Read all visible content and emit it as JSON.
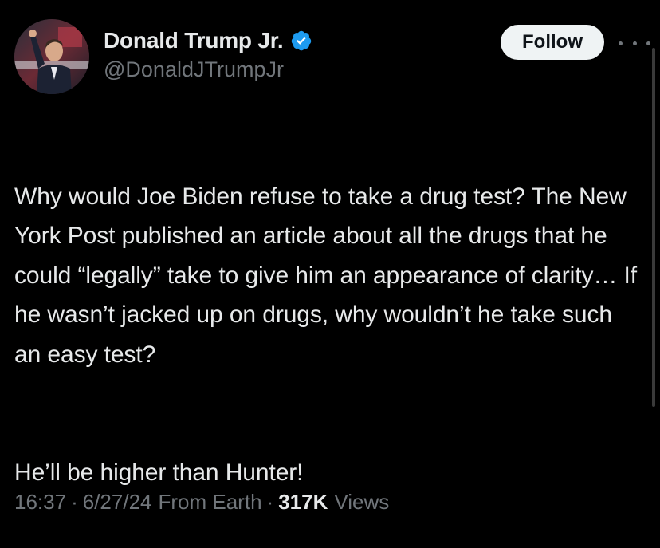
{
  "author": {
    "display_name": "Donald Trump Jr.",
    "handle": "@DonaldJTrumpJr",
    "verified": true,
    "verified_badge_color": "#1d9bf0"
  },
  "actions": {
    "follow_label": "Follow",
    "more_icon": "more-horizontal-icon"
  },
  "tweet": {
    "paragraphs": [
      "Why would Joe Biden refuse to take a drug test? The New York Post published an article about all the drugs that he could “legally” take to give him an appearance of clarity… If he wasn’t jacked up on drugs, why wouldn’t he take such an easy test?",
      "He’ll be higher than Hunter!"
    ]
  },
  "meta": {
    "time": "16:37",
    "separator": "·",
    "date": "6/27/24",
    "source": "From Earth",
    "views_count": "317K",
    "views_label": "Views"
  },
  "colors": {
    "background": "#000000",
    "text_primary": "#e7e9ea",
    "text_secondary": "#71767b",
    "follow_bg": "#eff3f4"
  }
}
